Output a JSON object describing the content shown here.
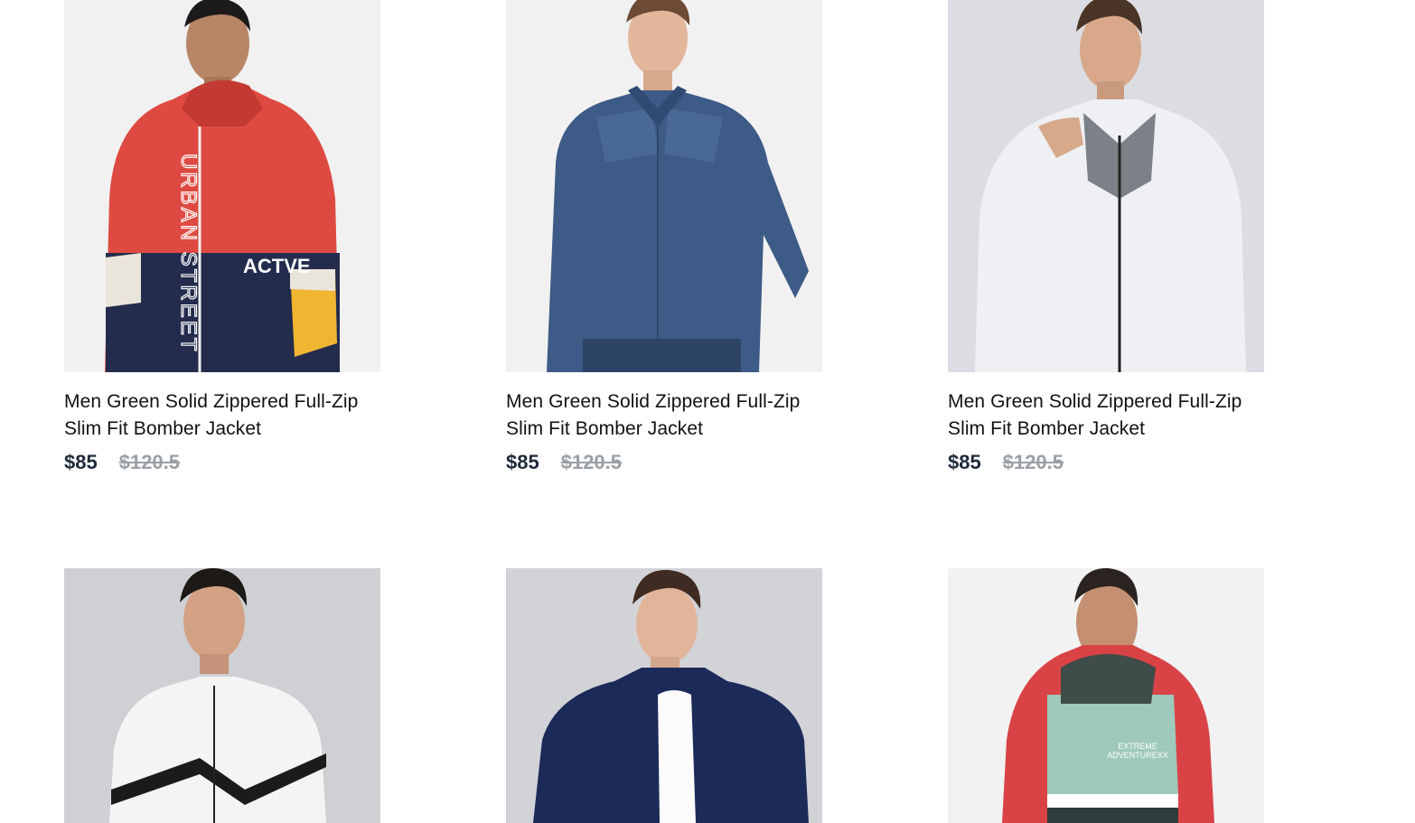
{
  "products": [
    {
      "title": "Men Green Solid Zippered Full-Zip Slim Fit Bomber Jacket",
      "price": "$85",
      "old_price": "$120.5",
      "image_name": "red-navy-windbreaker-photo",
      "print_text_1": "URBAN STREET",
      "print_text_2": "ACTVE"
    },
    {
      "title": "Men Green Solid Zippered Full-Zip Slim Fit Bomber Jacket",
      "price": "$85",
      "old_price": "$120.5",
      "image_name": "denim-jacket-photo"
    },
    {
      "title": "Men Green Solid Zippered Full-Zip Slim Fit Bomber Jacket",
      "price": "$85",
      "old_price": "$120.5",
      "image_name": "grey-track-jacket-photo"
    },
    {
      "image_name": "white-hooded-jacket-photo"
    },
    {
      "image_name": "navy-fleece-jacket-photo"
    },
    {
      "image_name": "red-mint-windbreaker-photo",
      "print_text_1": "EXTREME",
      "print_text_2": "ADVENTUREXX"
    }
  ],
  "colors": {
    "price": "#1e2a3b",
    "old_price": "#9aa0a6",
    "title": "#111111"
  }
}
